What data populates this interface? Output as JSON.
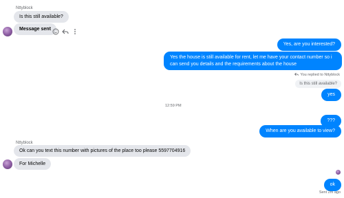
{
  "messages": {
    "first_group": {
      "sender": "Nttyblock",
      "m1": "Is this still available?",
      "m2": "Message sent"
    },
    "outgoing_1": {
      "m1": "Yes, are you interested?",
      "m2": "Yes the house is still available for rent, let me have your contact number so i can send you details and the requirements about the house"
    },
    "reply_context": {
      "label": "You replied to Nttyblock",
      "quoted": "Is this still available?",
      "reply": "yes"
    },
    "timestamp": "12:59 PM",
    "outgoing_2": {
      "m1": "???",
      "m2": "When are you available to view?"
    },
    "second_group": {
      "sender": "Nttyblock",
      "m1": "Ok can you text this number with pictures of the place too please 5597704916",
      "m2": "For Michelle"
    },
    "last": {
      "reply": "ok",
      "status": "Sent 2m ago"
    }
  },
  "icons": {
    "emoji": "smiley-icon",
    "reply": "reply-icon",
    "more": "more-icon"
  }
}
